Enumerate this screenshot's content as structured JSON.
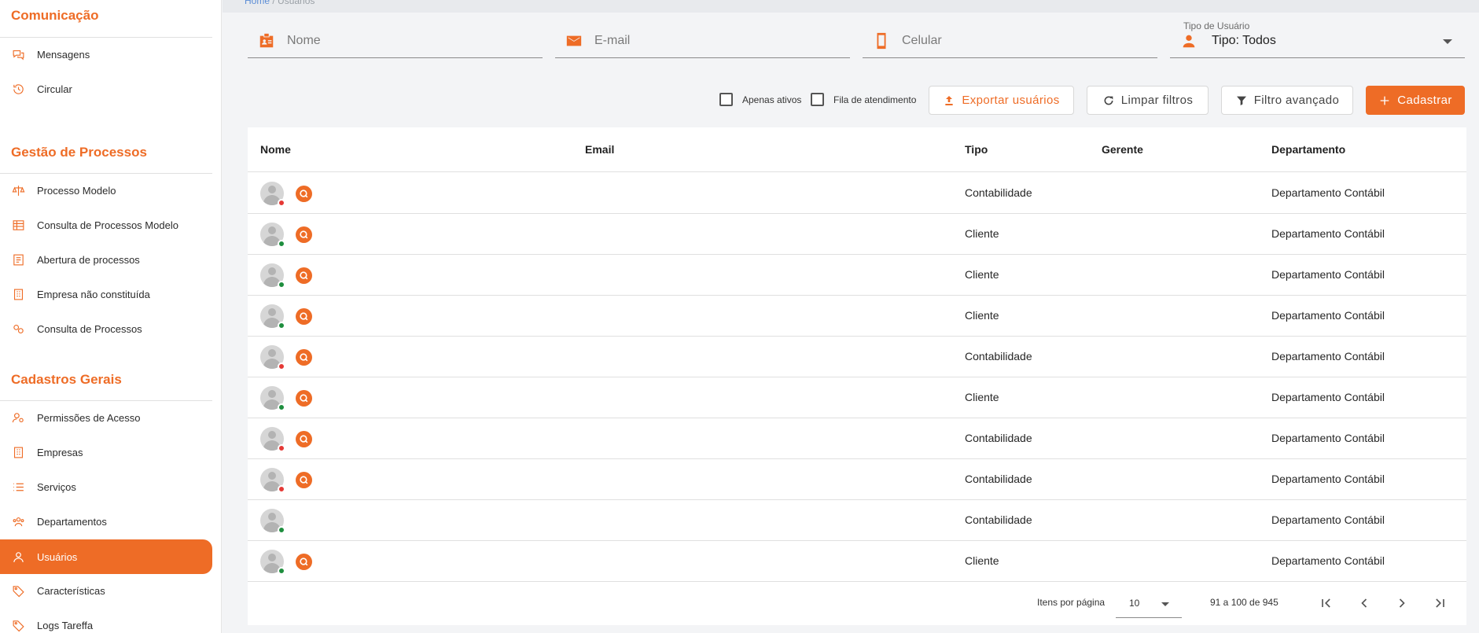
{
  "breadcrumb": {
    "home": "Home",
    "separator": "/",
    "current": "Usuários"
  },
  "sidebar": {
    "sections": [
      {
        "title": "Comunicação",
        "items": [
          {
            "label": "Mensagens",
            "icon": "chat-icon"
          },
          {
            "label": "Circular",
            "icon": "history-icon"
          }
        ]
      },
      {
        "title": "Gestão de Processos",
        "items": [
          {
            "label": "Processo Modelo",
            "icon": "scale-icon"
          },
          {
            "label": "Consulta de Processos Modelo",
            "icon": "table-icon"
          },
          {
            "label": "Abertura de processos",
            "icon": "checklist-icon"
          },
          {
            "label": "Empresa não constituída",
            "icon": "building-icon"
          },
          {
            "label": "Consulta de Processos",
            "icon": "gears-icon"
          }
        ]
      },
      {
        "title": "Cadastros Gerais",
        "items": [
          {
            "label": "Permissões de Acesso",
            "icon": "user-key-icon"
          },
          {
            "label": "Empresas",
            "icon": "building-icon"
          },
          {
            "label": "Serviços",
            "icon": "list-icon"
          },
          {
            "label": "Departamentos",
            "icon": "group-icon"
          },
          {
            "label": "Usuários",
            "icon": "user-icon",
            "active": true
          },
          {
            "label": "Características",
            "icon": "tag-icon"
          },
          {
            "label": "Logs Tareffa",
            "icon": "tag-icon"
          }
        ]
      }
    ]
  },
  "filters": {
    "nome_placeholder": "Nome",
    "email_placeholder": "E-mail",
    "celular_placeholder": "Celular",
    "tipo_label": "Tipo de Usuário",
    "tipo_value": "Tipo: Todos"
  },
  "actions": {
    "apenas_ativos": "Apenas ativos",
    "fila_atendimento": "Fila de atendimento",
    "exportar": "Exportar usuários",
    "limpar": "Limpar filtros",
    "filtro_avancado": "Filtro avançado",
    "cadastrar": "Cadastrar"
  },
  "table": {
    "headers": {
      "nome": "Nome",
      "email": "Email",
      "tipo": "Tipo",
      "gerente": "Gerente",
      "departamento": "Departamento"
    },
    "rows": [
      {
        "nome": "",
        "email": "",
        "tipo": "Contabilidade",
        "gerente": "",
        "departamento": "Departamento Contábil",
        "status": "offline",
        "badge": true
      },
      {
        "nome": "",
        "email": "",
        "tipo": "Cliente",
        "gerente": "",
        "departamento": "Departamento Contábil",
        "status": "online",
        "badge": true
      },
      {
        "nome": "",
        "email": "",
        "tipo": "Cliente",
        "gerente": "",
        "departamento": "Departamento Contábil",
        "status": "online",
        "badge": true
      },
      {
        "nome": "",
        "email": "",
        "tipo": "Cliente",
        "gerente": "",
        "departamento": "Departamento Contábil",
        "status": "online",
        "badge": true
      },
      {
        "nome": "",
        "email": "",
        "tipo": "Contabilidade",
        "gerente": "",
        "departamento": "Departamento Contábil",
        "status": "offline",
        "badge": true
      },
      {
        "nome": "",
        "email": "",
        "tipo": "Cliente",
        "gerente": "",
        "departamento": "Departamento Contábil",
        "status": "online",
        "badge": true
      },
      {
        "nome": "",
        "email": "",
        "tipo": "Contabilidade",
        "gerente": "",
        "departamento": "Departamento Contábil",
        "status": "offline",
        "badge": true
      },
      {
        "nome": "",
        "email": "",
        "tipo": "Contabilidade",
        "gerente": "",
        "departamento": "Departamento Contábil",
        "status": "offline",
        "badge": true
      },
      {
        "nome": "",
        "email": "",
        "tipo": "Contabilidade",
        "gerente": "",
        "departamento": "Departamento Contábil",
        "status": "online",
        "badge": false
      },
      {
        "nome": "",
        "email": "",
        "tipo": "Cliente",
        "gerente": "",
        "departamento": "Departamento Contábil",
        "status": "online",
        "badge": true
      }
    ]
  },
  "paginator": {
    "label": "Itens por página",
    "page_size": "10",
    "range": "91 a 100 de 945"
  },
  "colors": {
    "accent": "#ee6c26",
    "online": "#1e8e3e",
    "offline": "#e53935"
  }
}
